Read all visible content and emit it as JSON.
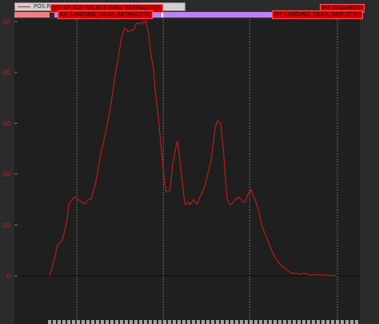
{
  "legend": {
    "label": "POS.R..."
  },
  "events": [
    {
      "id": "ap-alt",
      "label": "EV_AP_ALT_SELECT (FMA_RETRACTED)"
    },
    {
      "id": "gear-retracted",
      "label": "EV_LANDING_GEAR_RETRACTED"
    },
    {
      "id": "disarmed",
      "label": "EV_DISARMED"
    },
    {
      "id": "gear-deployed",
      "label": "EV_LANDING_GEAR_DEPLOYED"
    }
  ],
  "colors": {
    "series": "#cc1a1a",
    "phase_red": "#f08080",
    "phase_purple": "#bf7ff5",
    "event_bg": "#d40000",
    "plot_bg": "#1f1f1f",
    "grid": "#9a9a9a"
  },
  "chart_data": {
    "type": "line",
    "title": "",
    "xlabel": "",
    "ylabel": "",
    "ylim": [
      -190,
      1010
    ],
    "y_ticks": [
      {
        "value": 0,
        "label": "0"
      },
      {
        "value": 200,
        "label": "00"
      },
      {
        "value": 400,
        "label": "00"
      },
      {
        "value": 600,
        "label": "00"
      },
      {
        "value": 800,
        "label": "00"
      },
      {
        "value": 1000,
        "label": "00"
      }
    ],
    "grid": "vertical dotted",
    "xlim": [
      0,
      100
    ],
    "vertical_markers_x": [
      18.1,
      43.1,
      68.1,
      93.5
    ],
    "series": [
      {
        "x": [
          10.2,
          11.1,
          12.0,
          12.5,
          13.9,
          14.8,
          15.3,
          15.7,
          16.7,
          17.6,
          18.5,
          19.4,
          20.4,
          21.3,
          22.2,
          23.6,
          25.0,
          26.4,
          27.8,
          29.2,
          30.1,
          31.0,
          31.9,
          32.4,
          32.9,
          33.8,
          34.7,
          35.2,
          35.6,
          36.6,
          37.0,
          37.5,
          38.0,
          38.4,
          38.9,
          39.4,
          40.3,
          40.7,
          41.2,
          41.7,
          42.1,
          42.6,
          43.1,
          43.5,
          44.0,
          44.4,
          44.9,
          45.4,
          45.8,
          46.3,
          46.8,
          47.2,
          47.7,
          48.1,
          48.6,
          49.1,
          49.5,
          50.5,
          50.9,
          51.4,
          51.9,
          52.3,
          52.8,
          53.2,
          53.7,
          54.2,
          55.1,
          56.0,
          56.9,
          57.4,
          57.9,
          58.3,
          58.8,
          59.7,
          60.6,
          61.1,
          61.6,
          62.5,
          63.0,
          63.4,
          63.9,
          64.4,
          64.8,
          65.7,
          66.2,
          66.7,
          67.6,
          68.5,
          69.4,
          69.9,
          70.4,
          70.8,
          71.3,
          71.8,
          72.7,
          73.6,
          74.5,
          75.5,
          76.4,
          77.3,
          78.2,
          79.2,
          80.1,
          81.0,
          81.9,
          82.9,
          83.8,
          84.7,
          85.6,
          86.6,
          87.5,
          88.4,
          89.4,
          90.3,
          91.2,
          92.1,
          93.1
        ],
        "values": [
          0,
          40,
          90,
          120,
          140,
          190,
          225,
          280,
          300,
          310,
          300,
          290,
          282,
          300,
          300,
          370,
          480,
          560,
          660,
          790,
          860,
          935,
          975,
          970,
          960,
          965,
          970,
          990,
          995,
          990,
          1000,
          995,
          1005,
          980,
          950,
          885,
          810,
          740,
          680,
          620,
          560,
          490,
          420,
          365,
          330,
          330,
          330,
          380,
          440,
          470,
          510,
          530,
          480,
          430,
          370,
          310,
          280,
          290,
          280,
          290,
          300,
          290,
          282,
          290,
          310,
          320,
          350,
          400,
          450,
          500,
          560,
          590,
          610,
          600,
          480,
          380,
          300,
          280,
          285,
          290,
          300,
          303,
          310,
          300,
          290,
          290,
          320,
          340,
          310,
          290,
          270,
          250,
          220,
          190,
          160,
          130,
          100,
          70,
          55,
          40,
          30,
          20,
          10,
          10,
          8,
          5,
          10,
          5,
          3,
          3,
          5,
          3,
          2,
          2,
          1,
          0,
          0
        ]
      }
    ]
  }
}
